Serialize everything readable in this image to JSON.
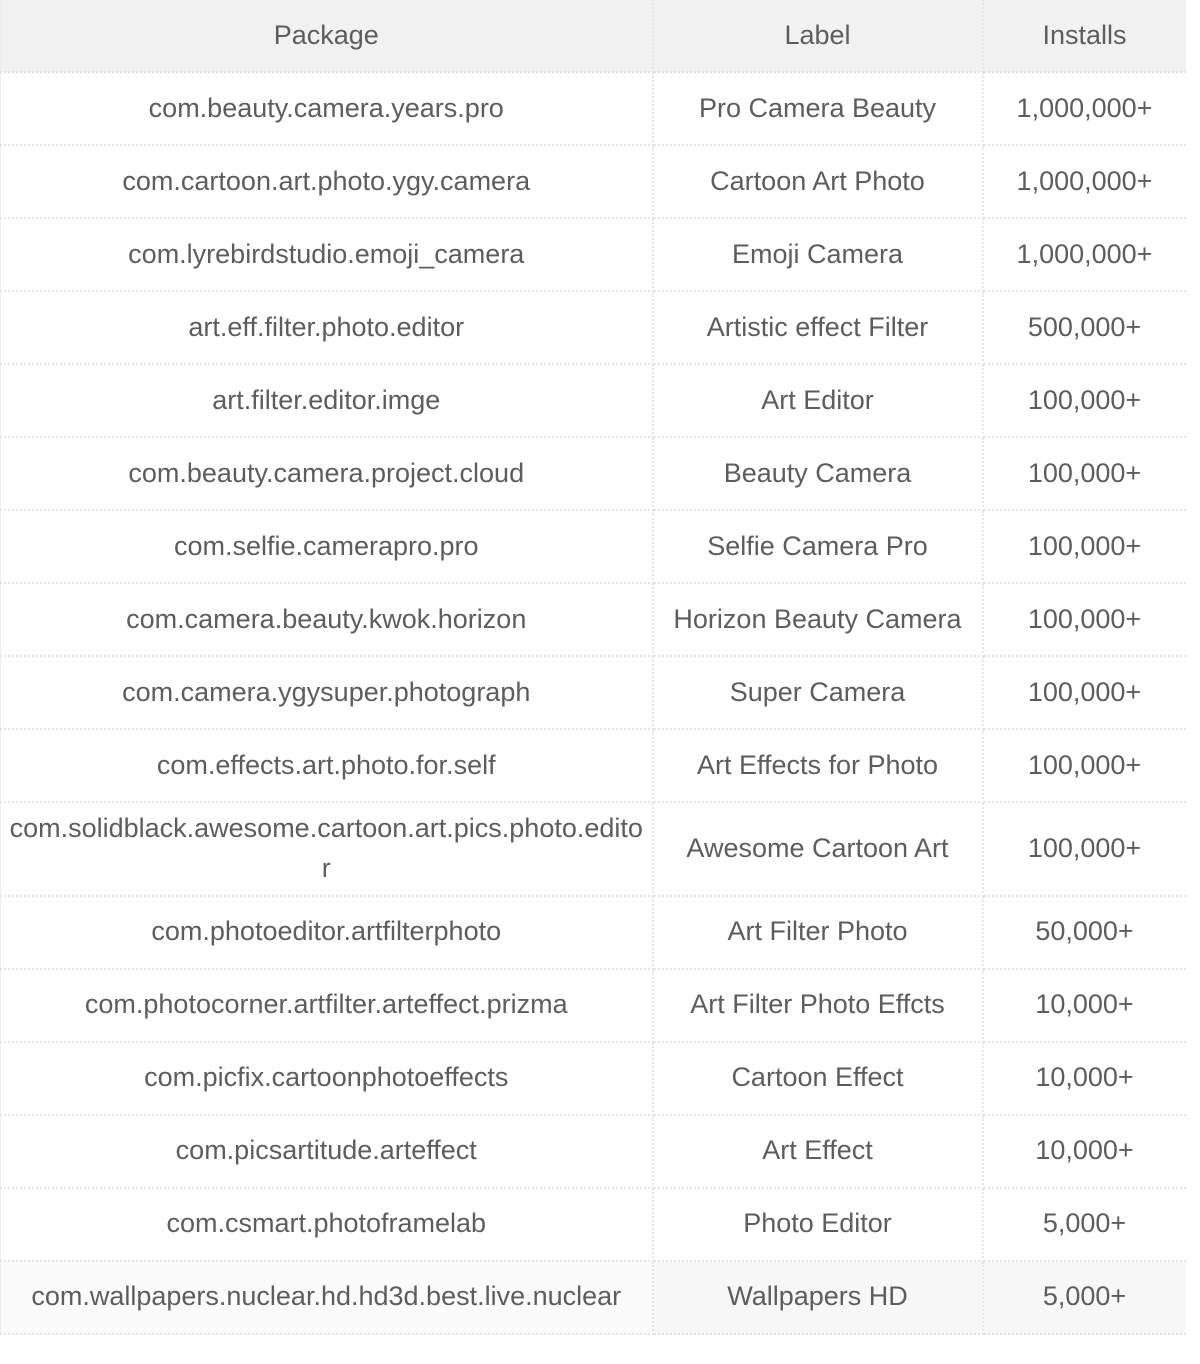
{
  "table": {
    "columns": [
      {
        "key": "package",
        "label": "Package"
      },
      {
        "key": "label",
        "label": "Label"
      },
      {
        "key": "installs",
        "label": "Installs"
      }
    ],
    "rows": [
      {
        "package": "com.beauty.camera.years.pro",
        "label": "Pro Camera Beauty",
        "installs": "1,000,000+"
      },
      {
        "package": "com.cartoon.art.photo.ygy.camera",
        "label": "Cartoon Art Photo",
        "installs": "1,000,000+"
      },
      {
        "package": "com.lyrebirdstudio.emoji_camera",
        "label": "Emoji Camera",
        "installs": "1,000,000+"
      },
      {
        "package": "art.eff.filter.photo.editor",
        "label": "Artistic effect Filter",
        "installs": "500,000+"
      },
      {
        "package": "art.filter.editor.imge",
        "label": "Art Editor",
        "installs": "100,000+"
      },
      {
        "package": "com.beauty.camera.project.cloud",
        "label": "Beauty Camera",
        "installs": "100,000+"
      },
      {
        "package": "com.selfie.camerapro.pro",
        "label": "Selfie Camera Pro",
        "installs": "100,000+"
      },
      {
        "package": "com.camera.beauty.kwok.horizon",
        "label": "Horizon Beauty Camera",
        "installs": "100,000+"
      },
      {
        "package": "com.camera.ygysuper.photograph",
        "label": "Super Camera",
        "installs": "100,000+"
      },
      {
        "package": "com.effects.art.photo.for.self",
        "label": "Art Effects for Photo",
        "installs": "100,000+"
      },
      {
        "package": "com.solidblack.awesome.cartoon.art.pics.photo.editor",
        "label": "Awesome Cartoon Art",
        "installs": "100,000+"
      },
      {
        "package": "com.photoeditor.artfilterphoto",
        "label": "Art Filter Photo",
        "installs": "50,000+"
      },
      {
        "package": "com.photocorner.artfilter.arteffect.prizma",
        "label": "Art Filter Photo Effcts",
        "installs": "10,000+"
      },
      {
        "package": "com.picfix.cartoonphotoeffects",
        "label": "Cartoon Effect",
        "installs": "10,000+"
      },
      {
        "package": "com.picsartitude.arteffect",
        "label": "Art Effect",
        "installs": "10,000+"
      },
      {
        "package": "com.csmart.photoframelab",
        "label": "Photo Editor",
        "installs": "5,000+"
      },
      {
        "package": "com.wallpapers.nuclear.hd.hd3d.best.live.nuclear",
        "label": "Wallpapers HD",
        "installs": "5,000+"
      }
    ]
  },
  "colors": {
    "text": "#5d5d5d",
    "header_bg": "#f1f1f1",
    "row_bg": "#ffffff",
    "border": "#e4e4e4"
  }
}
